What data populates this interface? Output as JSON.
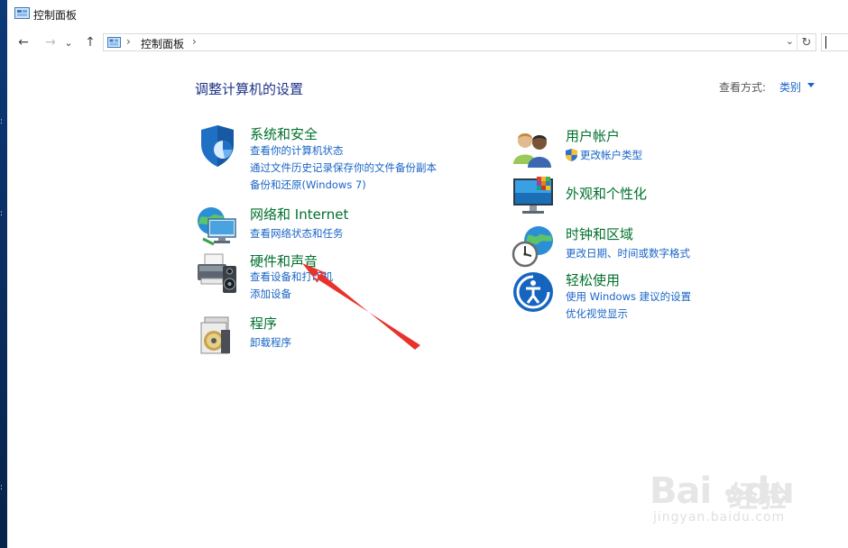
{
  "window": {
    "title": "控制面板"
  },
  "nav": {
    "back": "←",
    "forward": "→",
    "recent": "⌄",
    "up": "↑",
    "crumb_sep_1": "›",
    "crumb": "控制面板",
    "crumb_sep_2": "›",
    "dropdown": "⌄",
    "refresh": "↻"
  },
  "main": {
    "heading": "调整计算机的设置",
    "viewby_label": "查看方式:",
    "viewby_value": "类别"
  },
  "categories": [
    {
      "title": "系统和安全",
      "icon": "shield-security-icon",
      "links": [
        "查看你的计算机状态",
        "通过文件历史记录保存你的文件备份副本",
        "备份和还原(Windows 7)"
      ]
    },
    {
      "title": "网络和 Internet",
      "icon": "network-globe-icon",
      "links": [
        "查看网络状态和任务"
      ]
    },
    {
      "title": "硬件和声音",
      "icon": "printer-speaker-icon",
      "links": [
        "查看设备和打印机",
        "添加设备"
      ]
    },
    {
      "title": "程序",
      "icon": "programs-disc-icon",
      "links": [
        "卸载程序"
      ]
    },
    {
      "title": "用户帐户",
      "icon": "user-accounts-icon",
      "links": [
        "更改帐户类型"
      ]
    },
    {
      "title": "外观和个性化",
      "icon": "monitor-palette-icon",
      "links": []
    },
    {
      "title": "时钟和区域",
      "icon": "clock-globe-icon",
      "links": [
        "更改日期、时间或数字格式"
      ]
    },
    {
      "title": "轻松使用",
      "icon": "ease-of-access-icon",
      "links": [
        "使用 Windows 建议的设置",
        "优化视觉显示"
      ]
    }
  ],
  "watermark": {
    "logo_text": "Bai",
    "logo_text_2": "du",
    "jingyan": "经验",
    "url": "jingyan.baidu.com"
  },
  "colors": {
    "category_title": "#00702d",
    "link": "#1a65c6",
    "heading": "#1e3287",
    "annotation_arrow": "#e8332d"
  }
}
